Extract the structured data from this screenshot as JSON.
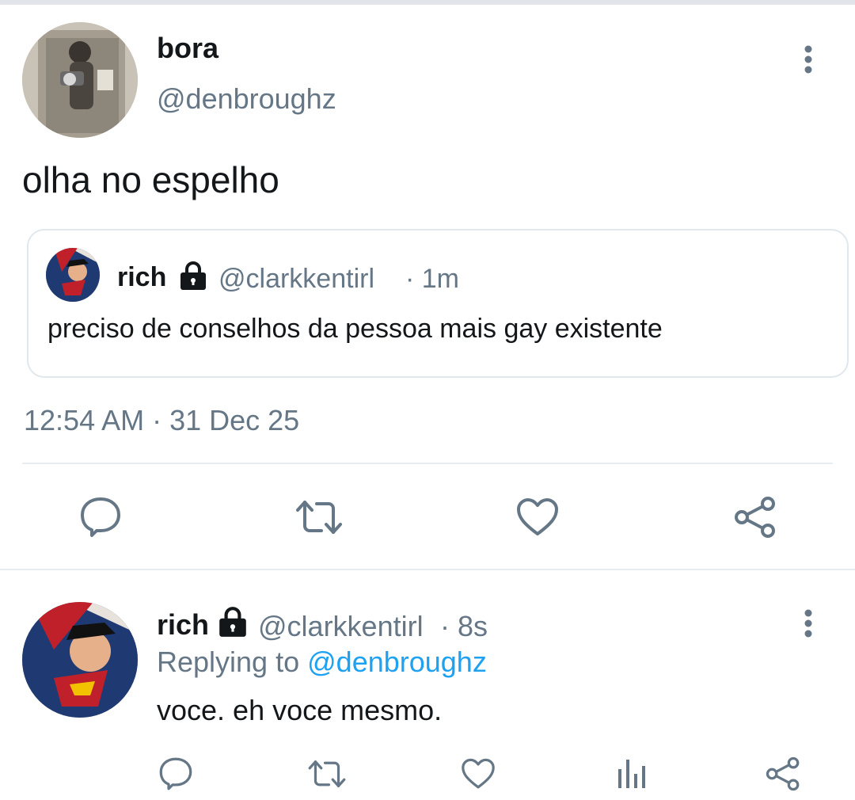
{
  "main_tweet": {
    "author_name": "bora",
    "author_handle": "@denbroughz",
    "text": "olha no espelho",
    "timestamp": "12:54 AM · 31 Dec 25",
    "avatar_icon": "mirror-selfie-photo",
    "more_icon": "more-vertical-icon"
  },
  "quoted_tweet": {
    "author_name": "rich",
    "lock_icon": "lock-icon",
    "author_handle": "@clarkkentirl",
    "time_ago": "· 1m",
    "text": "preciso de conselhos da pessoa mais gay existente"
  },
  "actions": [
    "reply-icon",
    "retweet-icon",
    "like-icon",
    "share-icon"
  ],
  "reply": {
    "author_name": "rich",
    "lock_icon": "lock-icon",
    "author_handle": "@clarkkentirl",
    "time_ago": "· 8s",
    "replying_prefix": "Replying to",
    "replying_to": "@denbroughz",
    "text": "voce. eh voce mesmo.",
    "actions": [
      "reply-icon",
      "retweet-icon",
      "like-icon",
      "analytics-icon",
      "share-icon"
    ]
  },
  "colors": {
    "text_primary": "#14171a",
    "text_muted": "#657786",
    "link": "#1da1f2",
    "divider": "#e6ecf0"
  }
}
